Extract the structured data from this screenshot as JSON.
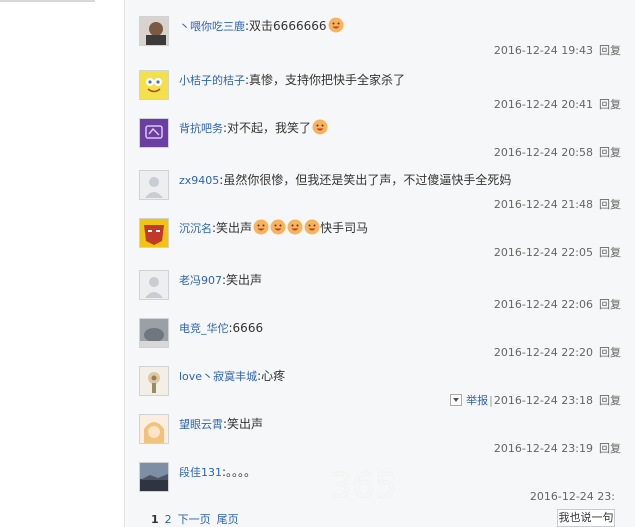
{
  "replies": [
    {
      "user": "丶喂你吃三鹿",
      "message": "双击6666666",
      "emojis": 1,
      "time": "2016-12-24 19:43",
      "reply": "回复",
      "avatar_icon": "photo-avatar-icon"
    },
    {
      "user": "小桔子的桔子",
      "message": "真惨，支持你把快手全家杀了",
      "emojis": 0,
      "time": "2016-12-24 20:41",
      "reply": "回复",
      "avatar_icon": "spongebob-avatar-icon"
    },
    {
      "user": "背抗吧务",
      "message": "对不起，我笑了",
      "emojis": 1,
      "time": "2016-12-24 20:58",
      "reply": "回复",
      "avatar_icon": "purple-badge-avatar-icon"
    },
    {
      "user": "zx9405",
      "message": "虽然你很惨，但我还是笑出了声，不过傻逼快手全死妈",
      "emojis": 0,
      "time": "2016-12-24 21:48",
      "reply": "回复",
      "avatar_icon": "default-avatar-icon"
    },
    {
      "user": "沉沉名",
      "message": "笑出声",
      "emojis": 4,
      "message_after": "快手司马",
      "time": "2016-12-24 22:05",
      "reply": "回复",
      "avatar_icon": "ironman-avatar-icon"
    },
    {
      "user": "老冯907",
      "message": "笑出声",
      "emojis": 0,
      "time": "2016-12-24 22:06",
      "reply": "回复",
      "avatar_icon": "default-avatar-icon"
    },
    {
      "user": "电竞_华佗",
      "message": "6666",
      "emojis": 0,
      "time": "2016-12-24 22:20",
      "reply": "回复",
      "avatar_icon": "gray-photo-avatar-icon"
    },
    {
      "user": "love丶寂寞丰城",
      "message": "心疼",
      "emojis": 0,
      "time": "2016-12-24 23:18",
      "reply": "回复",
      "report": "举报",
      "avatar_icon": "flower-avatar-icon"
    },
    {
      "user": "望眼云霄",
      "message": "笑出声",
      "emojis": 0,
      "time": "2016-12-24 23:19",
      "reply": "回复",
      "avatar_icon": "anime-avatar-icon"
    },
    {
      "user": "段佳131",
      "message": "。。。。",
      "emojis": 0,
      "time": "2016-12-24 23:",
      "reply": "",
      "avatar_icon": "landscape-avatar-icon"
    }
  ],
  "pager": {
    "page1": "1",
    "page2": "2",
    "next": "下一页",
    "last": "尾页"
  },
  "say_button": "我也说一句",
  "watermark": "365",
  "colors": {
    "link": "#2d64b3",
    "panel_bg": "#f6f7f8"
  }
}
